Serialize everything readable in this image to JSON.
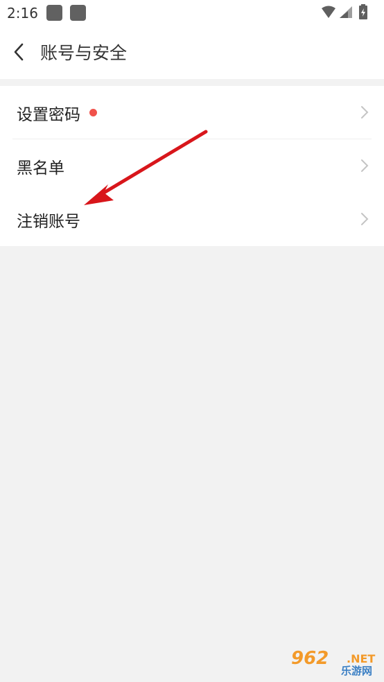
{
  "status_bar": {
    "time": "2:16",
    "icons": [
      "notification-square-icon",
      "notification-square-icon",
      "wifi-icon",
      "signal-icon",
      "battery-charging-icon"
    ]
  },
  "header": {
    "title": "账号与安全",
    "back_icon": "chevron-left-icon"
  },
  "settings_list": [
    {
      "label": "设置密码",
      "has_red_dot": true,
      "chevron": "chevron-right-icon"
    },
    {
      "label": "黑名单",
      "has_red_dot": false,
      "chevron": "chevron-right-icon"
    },
    {
      "label": "注销账号",
      "has_red_dot": false,
      "chevron": "chevron-right-icon"
    }
  ],
  "annotation": {
    "arrow_color": "#d8161b"
  },
  "watermark": {
    "number": "962",
    "suffix": ".NET",
    "sub": "乐游网"
  },
  "colors": {
    "accent_dot": "#f0524b",
    "background": "#f2f2f2"
  }
}
